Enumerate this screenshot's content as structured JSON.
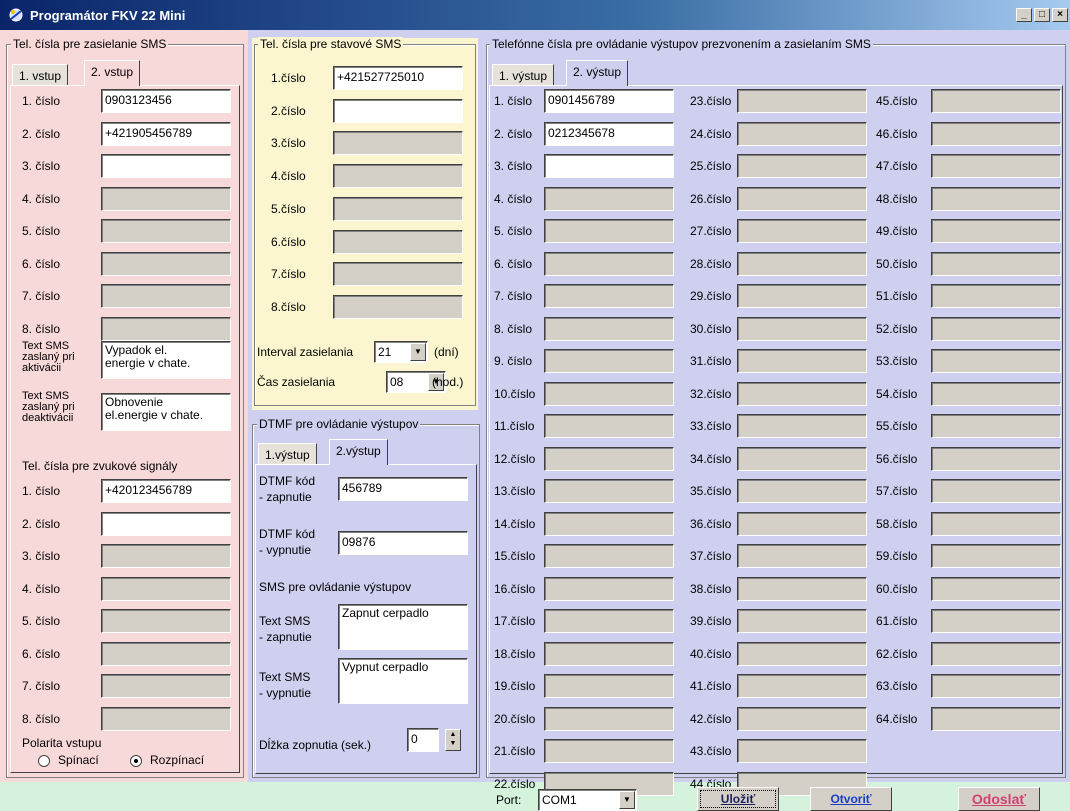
{
  "window": {
    "title": "Programátor FKV 22 Mini",
    "min": "_",
    "max": "□",
    "close": "×"
  },
  "colors": {
    "pink": "#f8d9d9",
    "yellow": "#fbf6cf",
    "lavender": "#cfd0f0",
    "green": "#d4f2dc",
    "titlebar": "#0a246a"
  },
  "sms": {
    "legend": "Tel. čísla pre zasielanie SMS",
    "tabs": [
      "1. vstup",
      "2. vstup"
    ],
    "rows": [
      {
        "label": "1. číslo",
        "value": "0903123456"
      },
      {
        "label": "2. číslo",
        "value": "+421905456789"
      },
      {
        "label": "3. číslo",
        "value": ""
      },
      {
        "label": "4. číslo",
        "value": ""
      },
      {
        "label": "5. číslo",
        "value": ""
      },
      {
        "label": "6. číslo",
        "value": ""
      },
      {
        "label": "7. číslo",
        "value": ""
      },
      {
        "label": "8. číslo",
        "value": ""
      }
    ],
    "act_label": "Text SMS\nzaslaný pri\naktivácii",
    "act_value": "Vypadok el.\nenergie v chate.",
    "deact_label": "Text SMS\nzaslaný pri\ndeaktivácii",
    "deact_value": "Obnovenie\nel.energie v chate.",
    "sound_title": "Tel. čísla pre zvukové signály",
    "sound_rows": [
      {
        "label": "1. číslo",
        "value": "+420123456789"
      },
      {
        "label": "2. číslo",
        "value": ""
      },
      {
        "label": "3. číslo",
        "value": ""
      },
      {
        "label": "4. číslo",
        "value": ""
      },
      {
        "label": "5. číslo",
        "value": ""
      },
      {
        "label": "6. číslo",
        "value": ""
      },
      {
        "label": "7. číslo",
        "value": ""
      },
      {
        "label": "8. číslo",
        "value": ""
      }
    ],
    "polarity_label": "Polarita vstupu",
    "polarity_options": [
      "Spínací",
      "Rozpínací"
    ],
    "polarity_selected": "Rozpínací"
  },
  "status": {
    "legend": "Tel. čísla pre stavové SMS",
    "rows": [
      {
        "label": "1.číslo",
        "value": "+421527725010"
      },
      {
        "label": "2.číslo",
        "value": ""
      },
      {
        "label": "3.číslo",
        "value": ""
      },
      {
        "label": "4.číslo",
        "value": ""
      },
      {
        "label": "5.číslo",
        "value": ""
      },
      {
        "label": "6.číslo",
        "value": ""
      },
      {
        "label": "7.číslo",
        "value": ""
      },
      {
        "label": "8.číslo",
        "value": ""
      }
    ],
    "interval_label": "Interval zasielania",
    "interval_value": "21",
    "interval_unit": "(dní)",
    "time_label": "Čas zasielania",
    "time_value": "08",
    "time_unit": "(hod.)"
  },
  "dtmf": {
    "legend": "DTMF pre ovládanie výstupov",
    "tabs": [
      "1.výstup",
      "2.výstup"
    ],
    "on_label": "DTMF kód\n- zapnutie",
    "on_value": "456789",
    "off_label": "DTMF kód\n- vypnutie",
    "off_value": "09876",
    "sms_title": "SMS pre ovládanie výstupov",
    "sms_on_label": "Text SMS\n- zapnutie",
    "sms_on_value": "Zapnut cerpadlo",
    "sms_off_label": "Text SMS\n- vypnutie",
    "sms_off_value": "Vypnut cerpadlo",
    "pulse_label": "Dĺžka zopnutia (sek.)",
    "pulse_value": "0"
  },
  "right": {
    "legend": "Telefónne čísla pre ovládanie výstupov prezvonením a zasielaním SMS",
    "tabs": [
      "1. výstup",
      "2. výstup"
    ],
    "col1": [
      {
        "label": "1. číslo",
        "value": "0901456789"
      },
      {
        "label": "2. číslo",
        "value": "0212345678"
      },
      {
        "label": "3. číslo",
        "value": ""
      },
      {
        "label": "4. číslo",
        "value": ""
      },
      {
        "label": "5. číslo",
        "value": ""
      },
      {
        "label": "6. číslo",
        "value": ""
      },
      {
        "label": "7. číslo",
        "value": ""
      },
      {
        "label": "8. číslo",
        "value": ""
      },
      {
        "label": "9. číslo",
        "value": ""
      },
      {
        "label": "10.číslo",
        "value": ""
      },
      {
        "label": "11.číslo",
        "value": ""
      },
      {
        "label": "12.číslo",
        "value": ""
      },
      {
        "label": "13.číslo",
        "value": ""
      },
      {
        "label": "14.číslo",
        "value": ""
      },
      {
        "label": "15.číslo",
        "value": ""
      },
      {
        "label": "16.číslo",
        "value": ""
      },
      {
        "label": "17.číslo",
        "value": ""
      },
      {
        "label": "18.číslo",
        "value": ""
      },
      {
        "label": "19.číslo",
        "value": ""
      },
      {
        "label": "20.číslo",
        "value": ""
      },
      {
        "label": "21.číslo",
        "value": ""
      },
      {
        "label": "22.číslo",
        "value": ""
      }
    ],
    "col2": [
      "23.číslo",
      "24.číslo",
      "25.číslo",
      "26.číslo",
      "27.číslo",
      "28.číslo",
      "29.číslo",
      "30.číslo",
      "31.číslo",
      "32.číslo",
      "33.číslo",
      "34.číslo",
      "35.číslo",
      "36.číslo",
      "37.číslo",
      "38.číslo",
      "39.číslo",
      "40.číslo",
      "41.číslo",
      "42.číslo",
      "43.číslo",
      "44.číslo"
    ],
    "col3": [
      "45.číslo",
      "46.číslo",
      "47.číslo",
      "48.číslo",
      "49.číslo",
      "50.číslo",
      "51.číslo",
      "52.číslo",
      "53.číslo",
      "54.číslo",
      "55.číslo",
      "56.číslo",
      "57.číslo",
      "58.číslo",
      "59.číslo",
      "60.číslo",
      "61.číslo",
      "62.číslo",
      "63.číslo",
      "64.číslo"
    ]
  },
  "footer": {
    "port_label": "Port:",
    "port_value": "COM1",
    "save": "Uložiť",
    "open": "Otvoriť",
    "send": "Odoslať"
  }
}
